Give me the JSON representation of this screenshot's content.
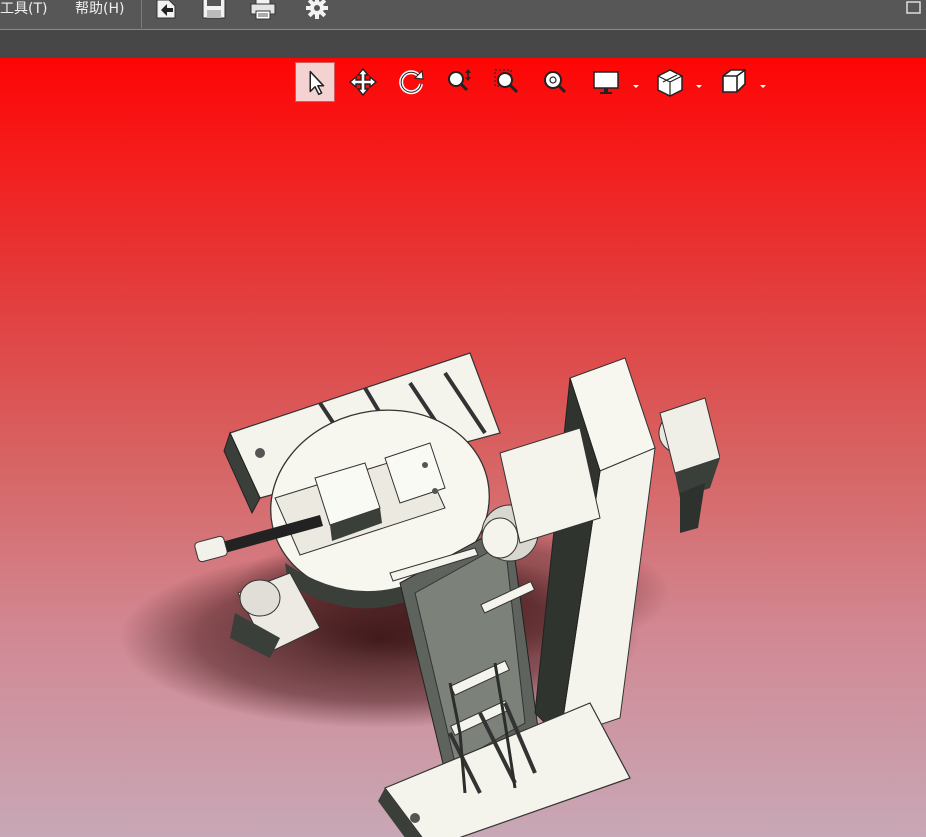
{
  "menu": {
    "tools_label": "工具(T)",
    "help_label": "帮助(H)"
  },
  "toolbar": {
    "icons": [
      "import-icon",
      "save-icon",
      "print-icon",
      "settings-gear-icon"
    ]
  },
  "view_tools": {
    "icons": [
      "select-arrow-icon",
      "pan-move-icon",
      "rotate-icon",
      "zoom-dynamic-icon",
      "zoom-window-icon",
      "zoom-fit-icon",
      "display-mode-icon",
      "section-view-icon",
      "view-orientation-cube-icon"
    ],
    "active": "select-arrow-icon"
  },
  "colors": {
    "topbar": "#575757",
    "viewport_top": "#fe0505",
    "viewport_bottom": "#c8a7b6",
    "model_light": "#f4f4ec",
    "model_dark": "#3a3f3a"
  }
}
